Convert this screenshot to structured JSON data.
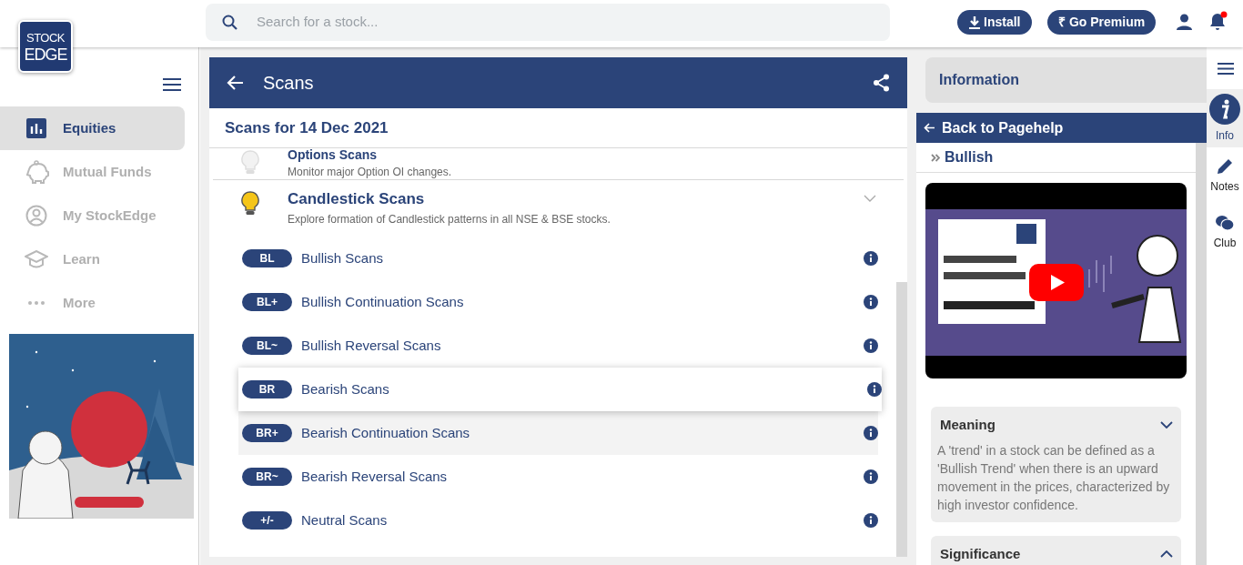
{
  "header": {
    "logo_lines": [
      "STOCK",
      "EDGE"
    ],
    "search_placeholder": "Search for a stock...",
    "install_label": "Install",
    "premium_label": "₹ Go Premium",
    "notification_unread": true
  },
  "sidebar": {
    "items": [
      {
        "label": "Equities",
        "selected": true
      },
      {
        "label": "Mutual Funds",
        "selected": false
      },
      {
        "label": "My StockEdge",
        "selected": false
      },
      {
        "label": "Learn",
        "selected": false
      },
      {
        "label": "More",
        "selected": false
      }
    ]
  },
  "main": {
    "title": "Scans",
    "subtitle": "Scans for 14 Dec 2021",
    "groups": [
      {
        "title": "Options Scans",
        "description": "Monitor major Option OI changes.",
        "expanded": false
      },
      {
        "title": "Candlestick Scans",
        "description": "Explore formation of Candlestick patterns in all NSE & BSE stocks.",
        "expanded": true
      }
    ],
    "scans": [
      {
        "badge": "BL",
        "label": "Bullish Scans",
        "selected": false,
        "hovered": false
      },
      {
        "badge": "BL+",
        "label": "Bullish Continuation Scans",
        "selected": false,
        "hovered": false
      },
      {
        "badge": "BL~",
        "label": "Bullish Reversal Scans",
        "selected": false,
        "hovered": false
      },
      {
        "badge": "BR",
        "label": "Bearish Scans",
        "selected": true,
        "hovered": false
      },
      {
        "badge": "BR+",
        "label": "Bearish Continuation Scans",
        "selected": false,
        "hovered": true
      },
      {
        "badge": "BR~",
        "label": "Bearish Reversal Scans",
        "selected": false,
        "hovered": false
      },
      {
        "badge": "+/-",
        "label": "Neutral Scans",
        "selected": false,
        "hovered": false
      }
    ]
  },
  "info_panel": {
    "title": "Information",
    "back_label": "Back to Pagehelp",
    "breadcrumb": "Bullish",
    "sections": [
      {
        "title": "Meaning",
        "expanded": true,
        "body": "A 'trend' in a stock can be defined as a 'Bullish Trend' when there is an upward movement in the prices, characterized by high investor confidence."
      },
      {
        "title": "Significance",
        "expanded": false
      }
    ]
  },
  "rail": {
    "items": [
      {
        "label": "Info",
        "selected": true
      },
      {
        "label": "Notes",
        "selected": false
      },
      {
        "label": "Club",
        "selected": false
      }
    ]
  }
}
